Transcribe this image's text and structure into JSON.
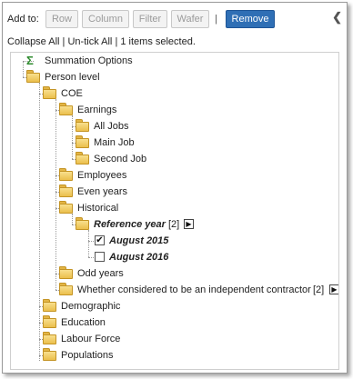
{
  "toolbar": {
    "add_to_label": "Add to:",
    "row_label": "Row",
    "column_label": "Column",
    "filter_label": "Filter",
    "wafer_label": "Wafer",
    "separator": "|",
    "remove_label": "Remove",
    "collapse_icon": "chevron-left-icon"
  },
  "subbar": {
    "collapse_all": "Collapse All",
    "sep1": "|",
    "untick_all": "Un-tick All",
    "sep2": "|",
    "selection_status": "1 items selected."
  },
  "tree": {
    "summation_options": "Summation Options",
    "person_level": "Person level",
    "coe": "COE",
    "earnings": "Earnings",
    "all_jobs": "All Jobs",
    "main_job": "Main Job",
    "second_job": "Second Job",
    "employees": "Employees",
    "even_years": "Even years",
    "historical": "Historical",
    "reference_year": "Reference year",
    "reference_year_count": "[2]",
    "august_2015": "August 2015",
    "august_2015_checked": true,
    "august_2016": "August 2016",
    "august_2016_checked": false,
    "odd_years": "Odd years",
    "independent_contractor": "Whether considered to be an independent contractor",
    "independent_contractor_count": "[2]",
    "demographic": "Demographic",
    "education": "Education",
    "labour_force": "Labour Force",
    "populations": "Populations"
  }
}
